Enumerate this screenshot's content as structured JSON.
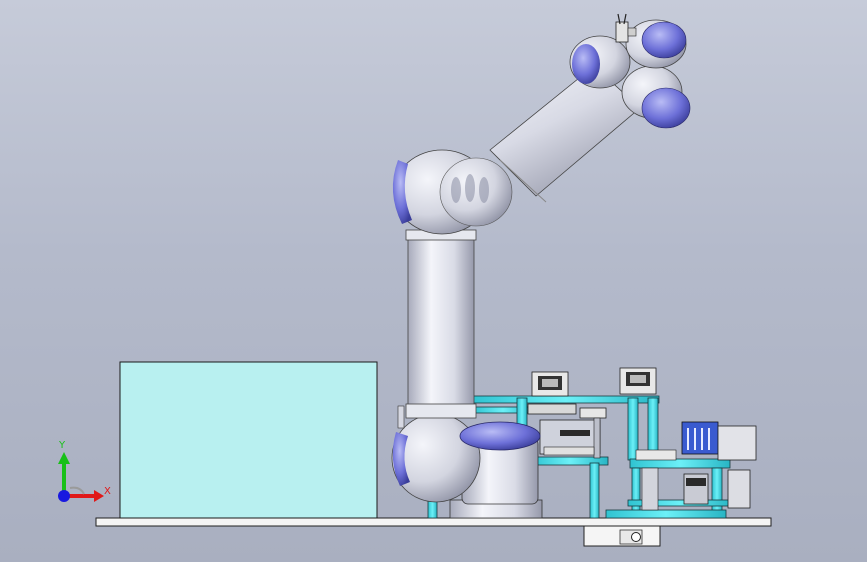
{
  "triad": {
    "x_label": "X",
    "y_label": "Y",
    "x_color": "#e01818",
    "y_color": "#18c018",
    "z_color": "#1818e0"
  },
  "colors": {
    "background_top": "#c6cbd9",
    "background_bottom": "#a9afc0",
    "robot_body": "#dcdee8",
    "joint_cap": "#6f72d6",
    "frame": "#39d7e4",
    "enclosure": "#b8f0f0",
    "base_plate": "#f2f2f2"
  }
}
